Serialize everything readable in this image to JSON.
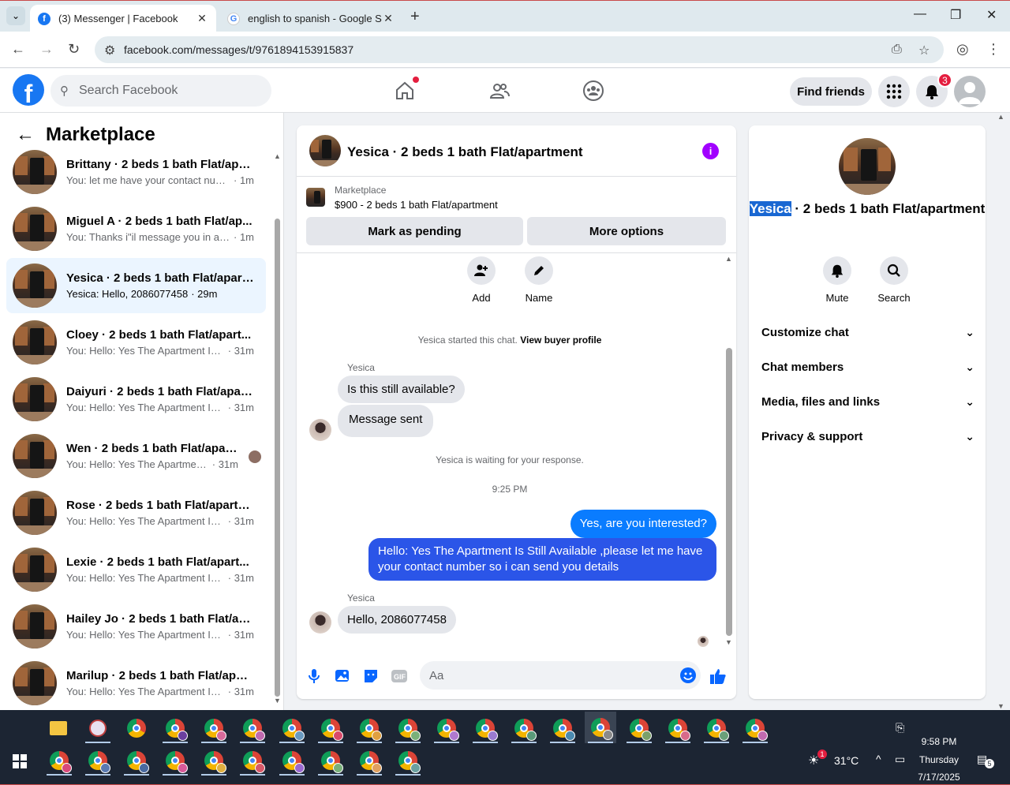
{
  "browser": {
    "tabs": [
      {
        "title": "(3) Messenger | Facebook",
        "active": true
      },
      {
        "title": "english to spanish - Google Sea",
        "active": false
      }
    ],
    "url": "facebook.com/messages/t/9761894153915837"
  },
  "header": {
    "search_placeholder": "Search Facebook",
    "find_friends": "Find friends",
    "notification_count": "3"
  },
  "left": {
    "title": "Marketplace",
    "conversations": [
      {
        "name": "Brittany · 2 beds 1 bath Flat/apa...",
        "message": "You: let me have your contact num...",
        "time": "· 1m"
      },
      {
        "name": "Miguel A · 2 beds 1 bath Flat/ap...",
        "message": "You: Thanks i\"il message you in a ...",
        "time": "· 1m"
      },
      {
        "name": "Yesica · 2 beds 1 bath Flat/apart...",
        "message": "Yesica: Hello, 2086077458",
        "time": "· 29m"
      },
      {
        "name": "Cloey · 2 beds 1 bath Flat/apart...",
        "message": "You: Hello: Yes The Apartment Is ...",
        "time": "· 31m"
      },
      {
        "name": "Daiyuri · 2 beds 1 bath Flat/apar...",
        "message": "You: Hello: Yes The Apartment Is ...",
        "time": "· 31m"
      },
      {
        "name": "Wen · 2 beds 1 bath Flat/apart...",
        "message": "You: Hello: Yes The Apartment ...",
        "time": "· 31m"
      },
      {
        "name": "Rose · 2 beds 1 bath Flat/apartm...",
        "message": "You: Hello: Yes The Apartment Is ...",
        "time": "· 31m"
      },
      {
        "name": "Lexie · 2 beds 1 bath Flat/apart...",
        "message": "You: Hello: Yes The Apartment Is ...",
        "time": "· 31m"
      },
      {
        "name": "Hailey Jo · 2 beds 1 bath Flat/ap...",
        "message": "You: Hello: Yes The Apartment Is ...",
        "time": "· 31m"
      },
      {
        "name": "Marilup · 2 beds 1 bath Flat/apar...",
        "message": "You: Hello: Yes The Apartment Is ...",
        "time": "· 31m"
      }
    ]
  },
  "chat": {
    "title": "Yesica · 2 beds 1 bath Flat/apartment",
    "marketplace_label": "Marketplace",
    "listing": "$900 - 2 beds 1 bath Flat/apartment",
    "mark_pending": "Mark as pending",
    "more_options": "More options",
    "add_label": "Add",
    "name_label": "Name",
    "started_text": "Yesica started this chat.",
    "view_profile": "View buyer profile",
    "sender_1": "Yesica",
    "msg_1": "Is this still available?",
    "msg_2": "Message sent",
    "waiting": "Yesica is waiting for your response.",
    "time_divider": "9:25 PM",
    "out_1": "Yes, are you interested?",
    "out_2": "Hello: Yes The Apartment Is Still Available ,please let me have your contact number so i can send you details",
    "sender_2": "Yesica",
    "msg_3": "Hello, 2086077458",
    "composer_placeholder": "Aa"
  },
  "right": {
    "name_highlight": "Yesica",
    "name_rest": " · 2 beds 1 bath Flat/apartment",
    "mute": "Mute",
    "search": "Search",
    "sections": [
      "Customize chat",
      "Chat members",
      "Media, files and links",
      "Privacy & support"
    ]
  },
  "taskbar": {
    "temperature": "31°C",
    "weather_badge": "1",
    "time": "9:58 PM",
    "day": "Thursday",
    "date": "7/17/2025",
    "notif_count": "5"
  },
  "colors": {
    "fb_blue": "#1877f2",
    "outgoing_bubble": "#0a7cff",
    "info_purple": "#a100ff",
    "selected_conv": "#ebf5ff"
  }
}
